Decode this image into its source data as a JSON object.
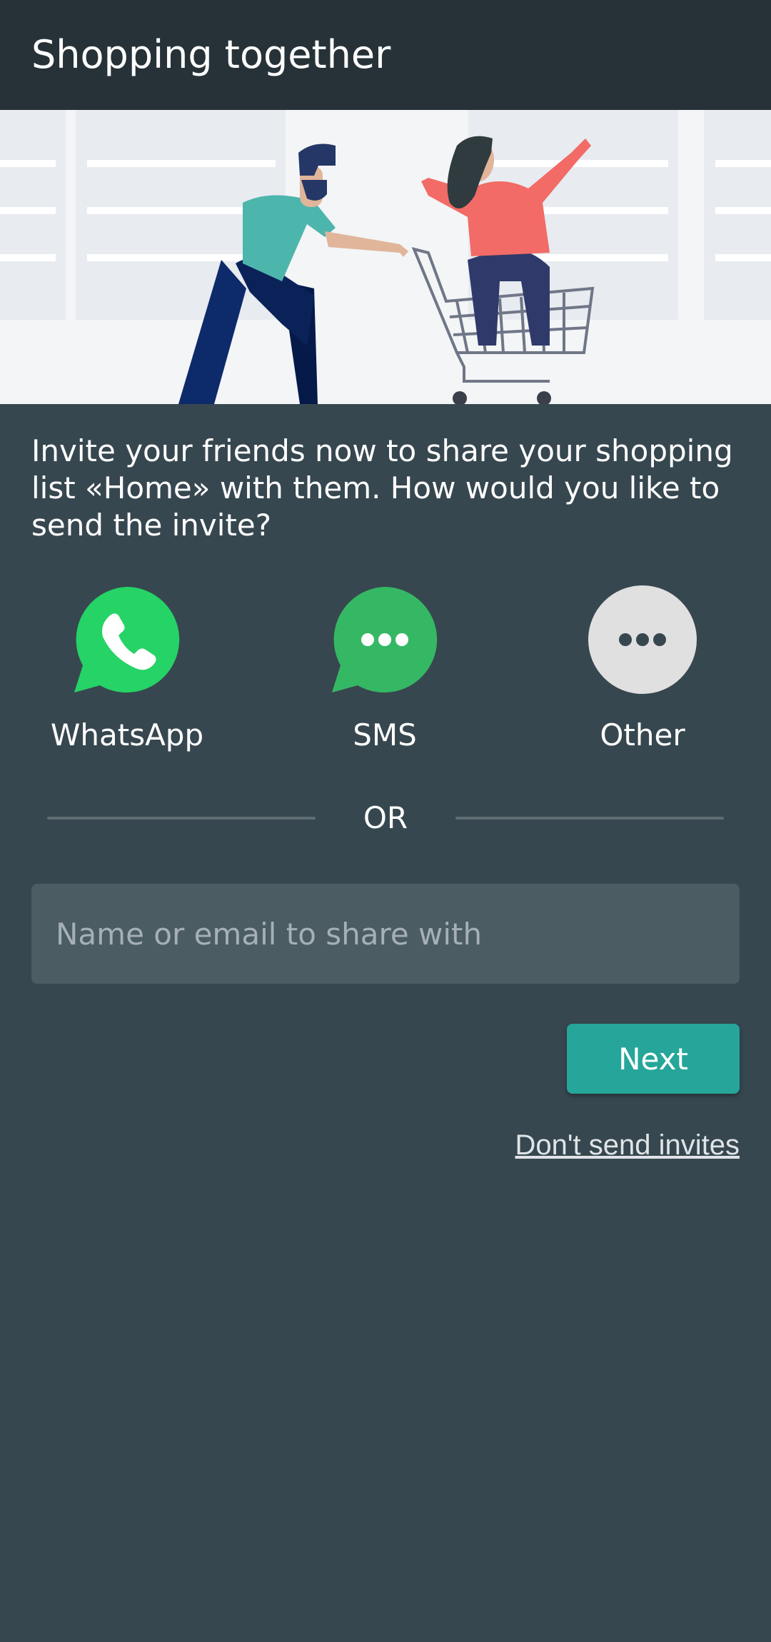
{
  "app_bar": {
    "title": "Shopping together"
  },
  "hero": {
    "illustration": "couple-with-shopping-cart-illustration"
  },
  "intro_text": "Invite your friends now to share your shopping list «Home» with them. How would you like to send the invite?",
  "share_options": [
    {
      "label": "WhatsApp",
      "icon": "whatsapp-icon",
      "color": "#25d366"
    },
    {
      "label": "SMS",
      "icon": "sms-icon",
      "color": "#35b864"
    },
    {
      "label": "Other",
      "icon": "more-icon",
      "color": "#e0e0e0"
    }
  ],
  "divider": {
    "text": "OR"
  },
  "share_input": {
    "value": "",
    "placeholder": "Name or email to share with"
  },
  "next_button": {
    "label": "Next",
    "color": "#26a69a"
  },
  "skip_link": {
    "label": "Don't send invites"
  },
  "colors": {
    "app_bar": "#263238",
    "background": "#37474f",
    "input_background": "#4b5c63"
  }
}
